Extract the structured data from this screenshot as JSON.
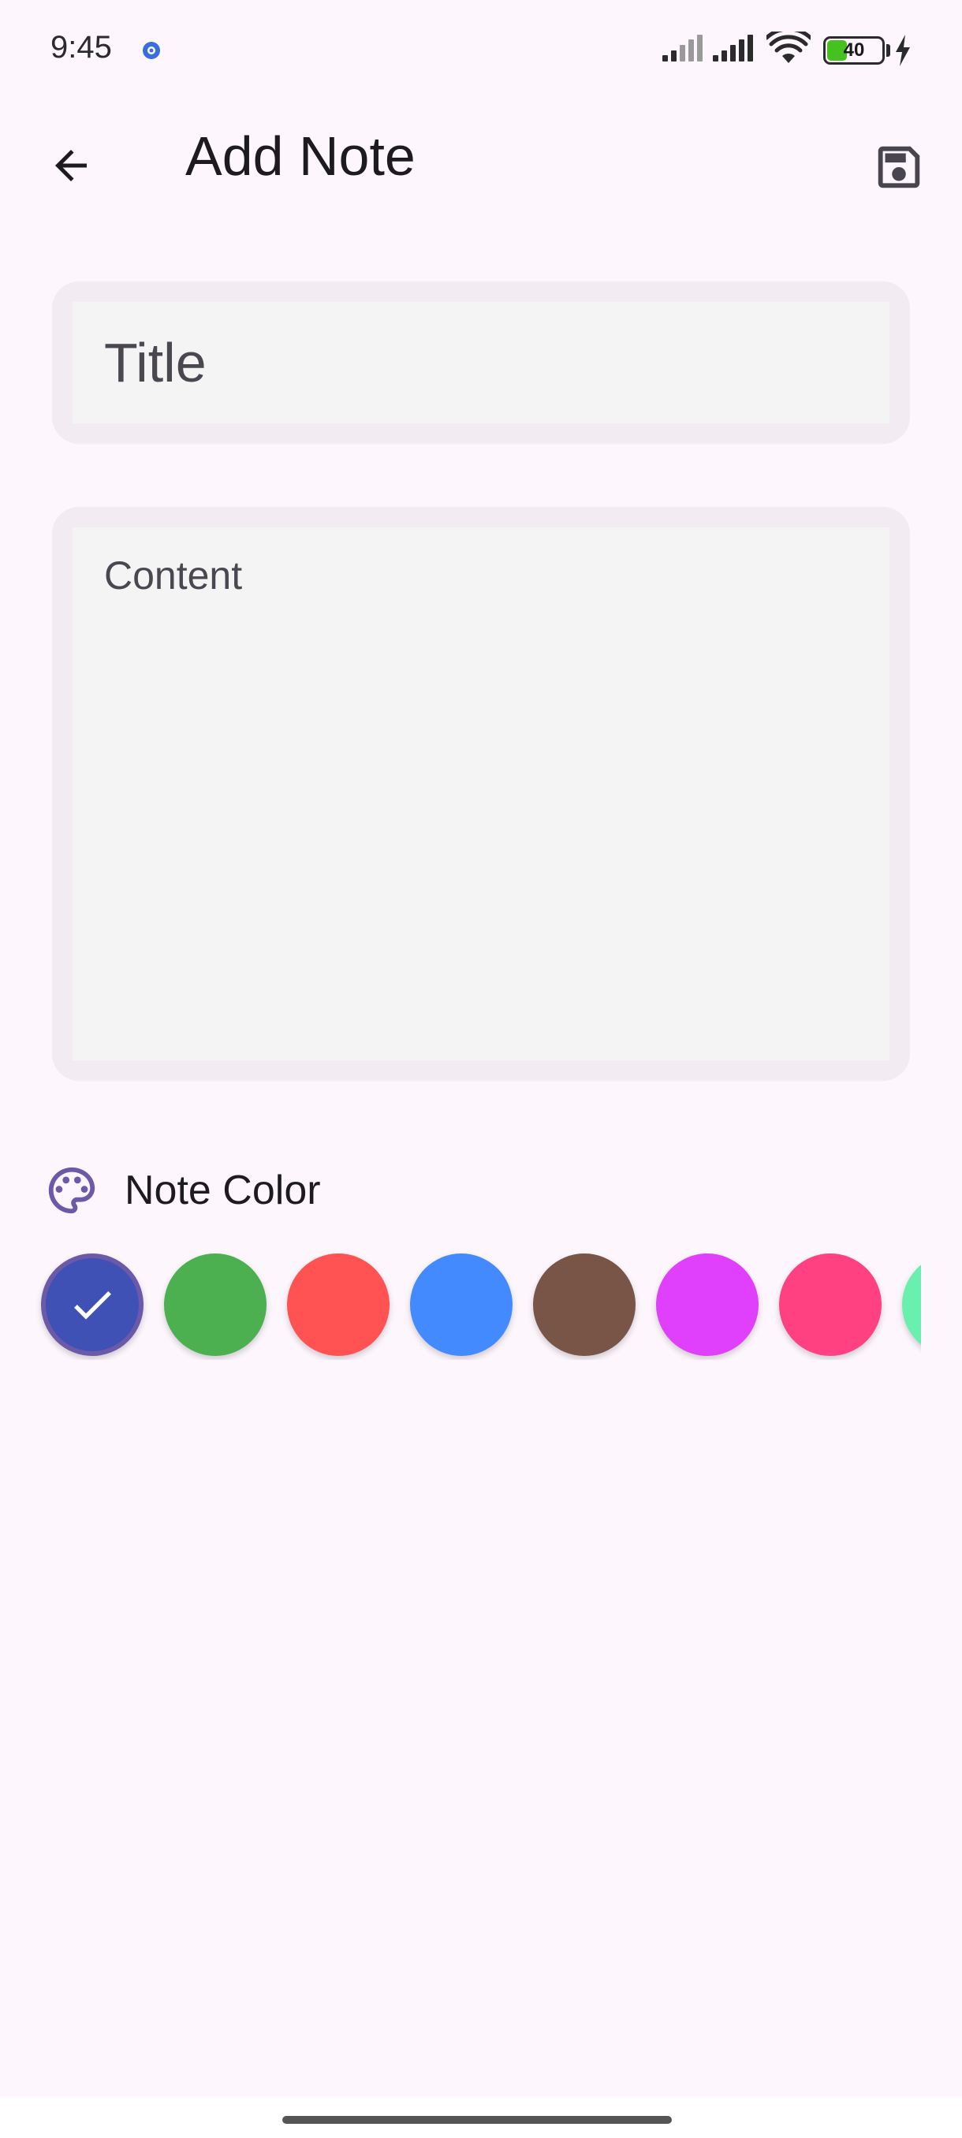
{
  "status_bar": {
    "time": "9:45",
    "battery_level": "40",
    "battery_fraction": 0.4
  },
  "app_bar": {
    "title": "Add Note",
    "back_icon": "arrow-back-icon",
    "save_icon": "save-icon"
  },
  "form": {
    "title_placeholder": "Title",
    "title_value": "",
    "content_placeholder": "Content",
    "content_value": ""
  },
  "color_section": {
    "label": "Note Color",
    "icon": "palette-icon",
    "selected_index": 0,
    "swatches": [
      {
        "name": "indigo",
        "color": "#3f51b5"
      },
      {
        "name": "green",
        "color": "#4caf50"
      },
      {
        "name": "red",
        "color": "#ff5252"
      },
      {
        "name": "blue",
        "color": "#448aff"
      },
      {
        "name": "brown",
        "color": "#795548"
      },
      {
        "name": "purple",
        "color": "#e040fb"
      },
      {
        "name": "pink",
        "color": "#ff4081"
      },
      {
        "name": "mint",
        "color": "#69f0ae"
      }
    ]
  },
  "theme": {
    "background": "#fdf7fd",
    "field_outer": "#f2ecf2",
    "field_inner": "#f4f4f4",
    "accent": "#6a5aa8"
  }
}
